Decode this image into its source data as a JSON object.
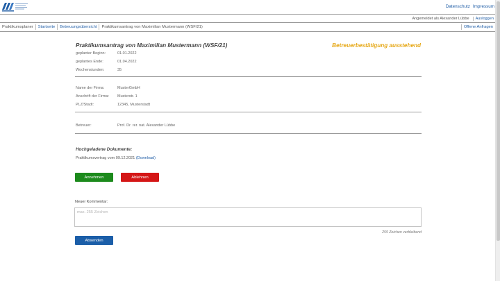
{
  "header": {
    "logo_alt": "Logo",
    "links": [
      "Datenschutz",
      "Impressum"
    ]
  },
  "user_bar": {
    "logged_in_text": "Angemeldet als Alexander Lübbe",
    "logout_label": "Ausloggen"
  },
  "nav": {
    "app_name": "Praktikumsplaner",
    "items": [
      "Startseite",
      "Betreuungsübersicht"
    ],
    "current": "Praktikumsantrag von Maximilian Mustermann (WSF/21)",
    "right_link": "Offene Anfragen"
  },
  "application": {
    "title": "Praktikumsantrag von Maximilian Mustermann (WSF/21)",
    "status": "Betreuerbestätigung ausstehend",
    "dates": [
      {
        "label": "geplanter Beginn:",
        "value": "01.01.2022"
      },
      {
        "label": "geplantes Ende:",
        "value": "01.04.2022"
      },
      {
        "label": "Wochenstunden:",
        "value": "35"
      }
    ],
    "company": [
      {
        "label": "Name der Firma:",
        "value": "MusterGmbH"
      },
      {
        "label": "Anschrift der Firma:",
        "value": "Musterstr. 1"
      },
      {
        "label": "PLZ/Stadt:",
        "value": "12345, Musterstadt"
      }
    ],
    "supervisor": {
      "label": "Betreuer:",
      "value": "Prof. Dr. rer. nat. Alexander Lübbe"
    }
  },
  "documents": {
    "heading": "Hochgeladene Dokumente:",
    "items": [
      {
        "text": "Praktikumsvertrag vom 09.12.2021",
        "link": "(Download)"
      }
    ]
  },
  "actions": {
    "accept": "Annehmen",
    "reject": "Ablehnen"
  },
  "comment": {
    "label": "Neuer Kommentar:",
    "placeholder": "max. 255 Zeichen",
    "value": "",
    "remaining": "255 Zeichen verbleibend",
    "submit": "Absenden"
  },
  "colors": {
    "link": "#1f5da6",
    "status": "#e6a817",
    "accept": "#1c8a1c",
    "reject": "#d41616",
    "submit": "#1b5ea8"
  }
}
